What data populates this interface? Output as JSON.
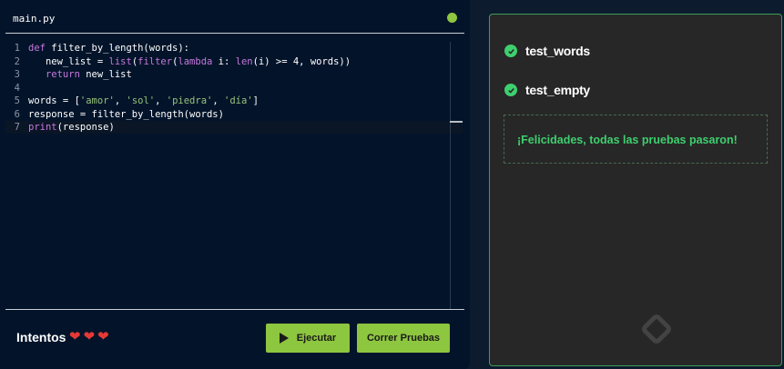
{
  "editor": {
    "file_name": "main.py",
    "status_color": "#8dc63f",
    "lines": [
      {
        "num": "1",
        "tokens": [
          {
            "t": "def",
            "c": "kw"
          },
          {
            "t": " filter_by_length(words):",
            "c": "fn"
          }
        ]
      },
      {
        "num": "2",
        "tokens": [
          {
            "t": "   new_list = ",
            "c": "fn"
          },
          {
            "t": "list",
            "c": "kw"
          },
          {
            "t": "(",
            "c": "fn"
          },
          {
            "t": "filter",
            "c": "kw"
          },
          {
            "t": "(",
            "c": "fn"
          },
          {
            "t": "lambda",
            "c": "kw"
          },
          {
            "t": " i: ",
            "c": "fn"
          },
          {
            "t": "len",
            "c": "kw"
          },
          {
            "t": "(i) >= 4, words))",
            "c": "fn"
          }
        ]
      },
      {
        "num": "3",
        "tokens": [
          {
            "t": "   ",
            "c": "fn"
          },
          {
            "t": "return",
            "c": "kw"
          },
          {
            "t": " new_list",
            "c": "fn"
          }
        ]
      },
      {
        "num": "4",
        "tokens": []
      },
      {
        "num": "5",
        "tokens": [
          {
            "t": "words = [",
            "c": "fn"
          },
          {
            "t": "'amor'",
            "c": "str"
          },
          {
            "t": ", ",
            "c": "fn"
          },
          {
            "t": "'sol'",
            "c": "str"
          },
          {
            "t": ", ",
            "c": "fn"
          },
          {
            "t": "'piedra'",
            "c": "str"
          },
          {
            "t": ", ",
            "c": "fn"
          },
          {
            "t": "'día'",
            "c": "str"
          },
          {
            "t": "]",
            "c": "fn"
          }
        ]
      },
      {
        "num": "6",
        "tokens": [
          {
            "t": "response = filter_by_length(words)",
            "c": "fn"
          }
        ]
      },
      {
        "num": "7",
        "tokens": [
          {
            "t": "print",
            "c": "kw"
          },
          {
            "t": "(response)",
            "c": "fn"
          }
        ],
        "active": true
      }
    ]
  },
  "footer": {
    "attempts_label": "Intentos",
    "hearts": [
      "❤",
      "❤",
      "❤"
    ],
    "run_label": "Ejecutar",
    "tests_label": "Correr Pruebas"
  },
  "tests": {
    "items": [
      {
        "name": "test_words",
        "status": "passed"
      },
      {
        "name": "test_empty",
        "status": "passed"
      }
    ],
    "success_message": "¡Felicidades, todas las pruebas pasaron!"
  },
  "colors": {
    "accent": "#8dc63f",
    "pass": "#3ecf6e",
    "heart": "#e53935"
  }
}
